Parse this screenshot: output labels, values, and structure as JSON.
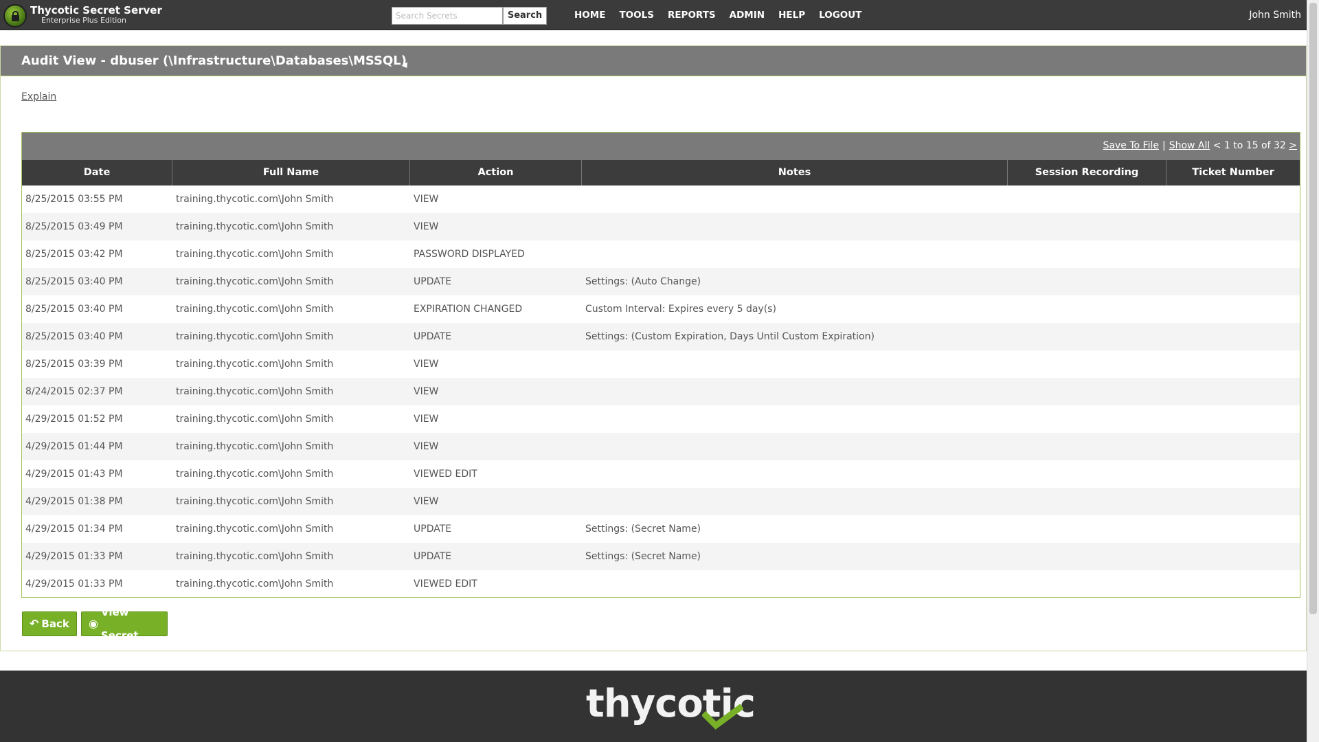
{
  "app": {
    "brand_title": "Thycotic Secret Server",
    "brand_subtitle": "Enterprise Plus Edition",
    "accent_color": "#78b128",
    "header_color": "#3b3b3b"
  },
  "search": {
    "placeholder": "Search Secrets",
    "button_label": "Search"
  },
  "nav": {
    "items": [
      "HOME",
      "TOOLS",
      "REPORTS",
      "ADMIN",
      "HELP",
      "LOGOUT"
    ]
  },
  "user": {
    "name": "John Smith"
  },
  "page": {
    "title": "Audit View - dbuser (\\Infrastructure\\Databases\\MSSQL)",
    "explain_link": "Explain"
  },
  "table": {
    "save_to_file": "Save To File",
    "show_all": "Show All",
    "pager_prev": "<",
    "pager_text": "1 to 15 of 32",
    "pager_next": ">",
    "columns": [
      "Date",
      "Full Name",
      "Action",
      "Notes",
      "Session Recording",
      "Ticket Number"
    ],
    "rows": [
      {
        "date": "8/25/2015 03:55 PM",
        "name": "training.thycotic.com\\John Smith",
        "action": "VIEW",
        "notes": "",
        "session": "",
        "ticket": ""
      },
      {
        "date": "8/25/2015 03:49 PM",
        "name": "training.thycotic.com\\John Smith",
        "action": "VIEW",
        "notes": "",
        "session": "",
        "ticket": ""
      },
      {
        "date": "8/25/2015 03:42 PM",
        "name": "training.thycotic.com\\John Smith",
        "action": "PASSWORD DISPLAYED",
        "notes": "",
        "session": "",
        "ticket": ""
      },
      {
        "date": "8/25/2015 03:40 PM",
        "name": "training.thycotic.com\\John Smith",
        "action": "UPDATE",
        "notes": "Settings: (Auto Change)",
        "session": "",
        "ticket": ""
      },
      {
        "date": "8/25/2015 03:40 PM",
        "name": "training.thycotic.com\\John Smith",
        "action": "EXPIRATION CHANGED",
        "notes": "Custom Interval: Expires every 5 day(s)",
        "session": "",
        "ticket": ""
      },
      {
        "date": "8/25/2015 03:40 PM",
        "name": "training.thycotic.com\\John Smith",
        "action": "UPDATE",
        "notes": "Settings: (Custom Expiration, Days Until Custom Expiration)",
        "session": "",
        "ticket": ""
      },
      {
        "date": "8/25/2015 03:39 PM",
        "name": "training.thycotic.com\\John Smith",
        "action": "VIEW",
        "notes": "",
        "session": "",
        "ticket": ""
      },
      {
        "date": "8/24/2015 02:37 PM",
        "name": "training.thycotic.com\\John Smith",
        "action": "VIEW",
        "notes": "",
        "session": "",
        "ticket": ""
      },
      {
        "date": "4/29/2015 01:52 PM",
        "name": "training.thycotic.com\\John Smith",
        "action": "VIEW",
        "notes": "",
        "session": "",
        "ticket": ""
      },
      {
        "date": "4/29/2015 01:44 PM",
        "name": "training.thycotic.com\\John Smith",
        "action": "VIEW",
        "notes": "",
        "session": "",
        "ticket": ""
      },
      {
        "date": "4/29/2015 01:43 PM",
        "name": "training.thycotic.com\\John Smith",
        "action": "VIEWED EDIT",
        "notes": "",
        "session": "",
        "ticket": ""
      },
      {
        "date": "4/29/2015 01:38 PM",
        "name": "training.thycotic.com\\John Smith",
        "action": "VIEW",
        "notes": "",
        "session": "",
        "ticket": ""
      },
      {
        "date": "4/29/2015 01:34 PM",
        "name": "training.thycotic.com\\John Smith",
        "action": "UPDATE",
        "notes": "Settings: (Secret Name)",
        "session": "",
        "ticket": ""
      },
      {
        "date": "4/29/2015 01:33 PM",
        "name": "training.thycotic.com\\John Smith",
        "action": "UPDATE",
        "notes": "Settings: (Secret Name)",
        "session": "",
        "ticket": ""
      },
      {
        "date": "4/29/2015 01:33 PM",
        "name": "training.thycotic.com\\John Smith",
        "action": "VIEWED EDIT",
        "notes": "",
        "session": "",
        "ticket": ""
      }
    ]
  },
  "buttons": {
    "back_label": "Back",
    "back_icon": "reply-arrow-icon",
    "view_secret_label": "View Secret",
    "view_secret_icon": "eye-icon"
  },
  "footer": {
    "logo_text": "thycotic",
    "logo_check_color": "#78b128"
  }
}
